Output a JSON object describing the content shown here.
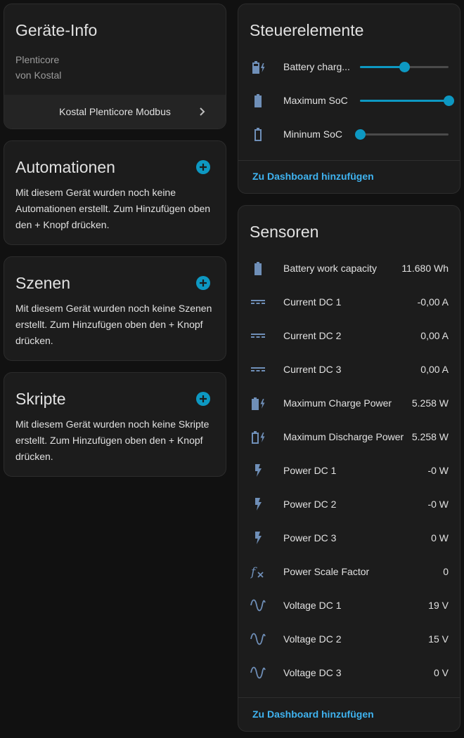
{
  "device_info": {
    "title": "Geräte-Info",
    "model": "Plenticore",
    "manufacturer": "von Kostal",
    "device_link": "Kostal Plenticore Modbus"
  },
  "automations": {
    "title": "Automationen",
    "text": "Mit diesem Gerät wurden noch keine Automationen erstellt. Zum Hinzufügen oben den + Knopf drücken."
  },
  "scenes": {
    "title": "Szenen",
    "text": "Mit diesem Gerät wurden noch keine Szenen erstellt. Zum Hinzufügen oben den + Knopf drücken."
  },
  "scripts": {
    "title": "Skripte",
    "text": "Mit diesem Gerät wurden noch keine Skripte erstellt. Zum Hinzufügen oben den + Knopf drücken."
  },
  "controls": {
    "title": "Steuerelemente",
    "items": [
      {
        "label": "Battery charg...",
        "icon": "battery-charging-icon",
        "value_fraction": 0.5
      },
      {
        "label": "Maximum SoC",
        "icon": "battery-icon",
        "value_fraction": 1.0
      },
      {
        "label": "Mininum SoC",
        "icon": "battery-outline-icon",
        "value_fraction": 0.0
      }
    ],
    "add_to_dashboard": "Zu Dashboard hinzufügen"
  },
  "sensors": {
    "title": "Sensoren",
    "items": [
      {
        "label": "Battery work capacity",
        "value": "11.680 Wh",
        "icon": "battery-icon"
      },
      {
        "label": "Current DC 1",
        "value": "-0,00 A",
        "icon": "current-dc-icon"
      },
      {
        "label": "Current DC 2",
        "value": "0,00 A",
        "icon": "current-dc-icon"
      },
      {
        "label": "Current DC 3",
        "value": "0,00 A",
        "icon": "current-dc-icon"
      },
      {
        "label": "Maximum Charge Power",
        "value": "5.258 W",
        "icon": "battery-charging-icon"
      },
      {
        "label": "Maximum Discharge Power",
        "value": "5.258 W",
        "icon": "battery-charging-outline-icon"
      },
      {
        "label": "Power DC 1",
        "value": "-0 W",
        "icon": "flash-icon"
      },
      {
        "label": "Power DC 2",
        "value": "-0 W",
        "icon": "flash-icon"
      },
      {
        "label": "Power DC 3",
        "value": "0 W",
        "icon": "flash-icon"
      },
      {
        "label": "Power Scale Factor",
        "value": "0",
        "icon": "function-icon"
      },
      {
        "label": "Voltage DC 1",
        "value": "19 V",
        "icon": "sine-wave-icon"
      },
      {
        "label": "Voltage DC 2",
        "value": "15 V",
        "icon": "sine-wave-icon"
      },
      {
        "label": "Voltage DC 3",
        "value": "0 V",
        "icon": "sine-wave-icon"
      }
    ],
    "add_to_dashboard": "Zu Dashboard hinzufügen"
  },
  "colors": {
    "accent": "#0d98c2",
    "link": "#3fb3f0",
    "icon": "#6f8fb8",
    "card": "#1c1c1c",
    "background": "#111111"
  }
}
